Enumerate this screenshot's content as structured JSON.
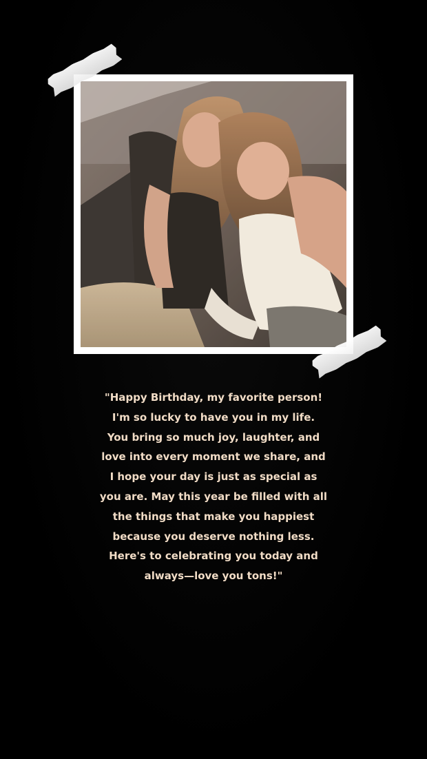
{
  "photo": {
    "subject": "photo-of-two-friends"
  },
  "message": {
    "text": "\"Happy Birthday, my favorite person!\nI'm so lucky to have you in my life.\nYou bring so much joy, laughter, and\nlove into every moment we share, and\nI hope your day is just as special as\nyou are. May this year be filled with all\nthe things that make you happiest\nbecause you deserve nothing less.\nHere's to celebrating you today and\nalways—love you tons!\""
  },
  "colors": {
    "background": "#000000",
    "frame": "#ffffff",
    "text": "#f1dcc6"
  }
}
